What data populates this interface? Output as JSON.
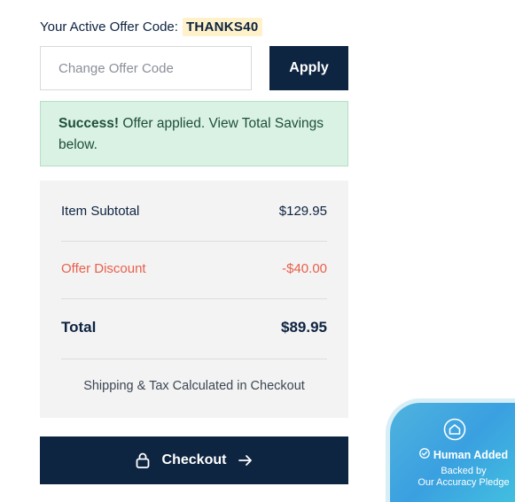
{
  "offer": {
    "active_label": "Your Active Offer Code:",
    "active_code": "THANKS40",
    "input_placeholder": "Change Offer Code",
    "input_value": "",
    "apply_label": "Apply"
  },
  "success": {
    "title": "Success!",
    "message": "Offer applied. View Total Savings below."
  },
  "summary": {
    "subtotal_label": "Item Subtotal",
    "subtotal_value": "$129.95",
    "discount_label": "Offer Discount",
    "discount_value": "-$40.00",
    "total_label": "Total",
    "total_value": "$89.95",
    "shipping_note": "Shipping & Tax Calculated in Checkout"
  },
  "checkout": {
    "label": "Checkout",
    "lock_icon": "lock-icon",
    "arrow_icon": "arrow-right-icon"
  },
  "pledge": {
    "title": "Human Added",
    "subtitle_line1": "Backed by",
    "subtitle_line2": "Our Accuracy Pledge",
    "icon": "home-shield-icon"
  },
  "colors": {
    "navy": "#0e2541",
    "success_bg": "#daf2e4",
    "discount_red": "#e8604c",
    "code_highlight": "#fff1c9",
    "badge_blue": "#3aa0e0"
  }
}
